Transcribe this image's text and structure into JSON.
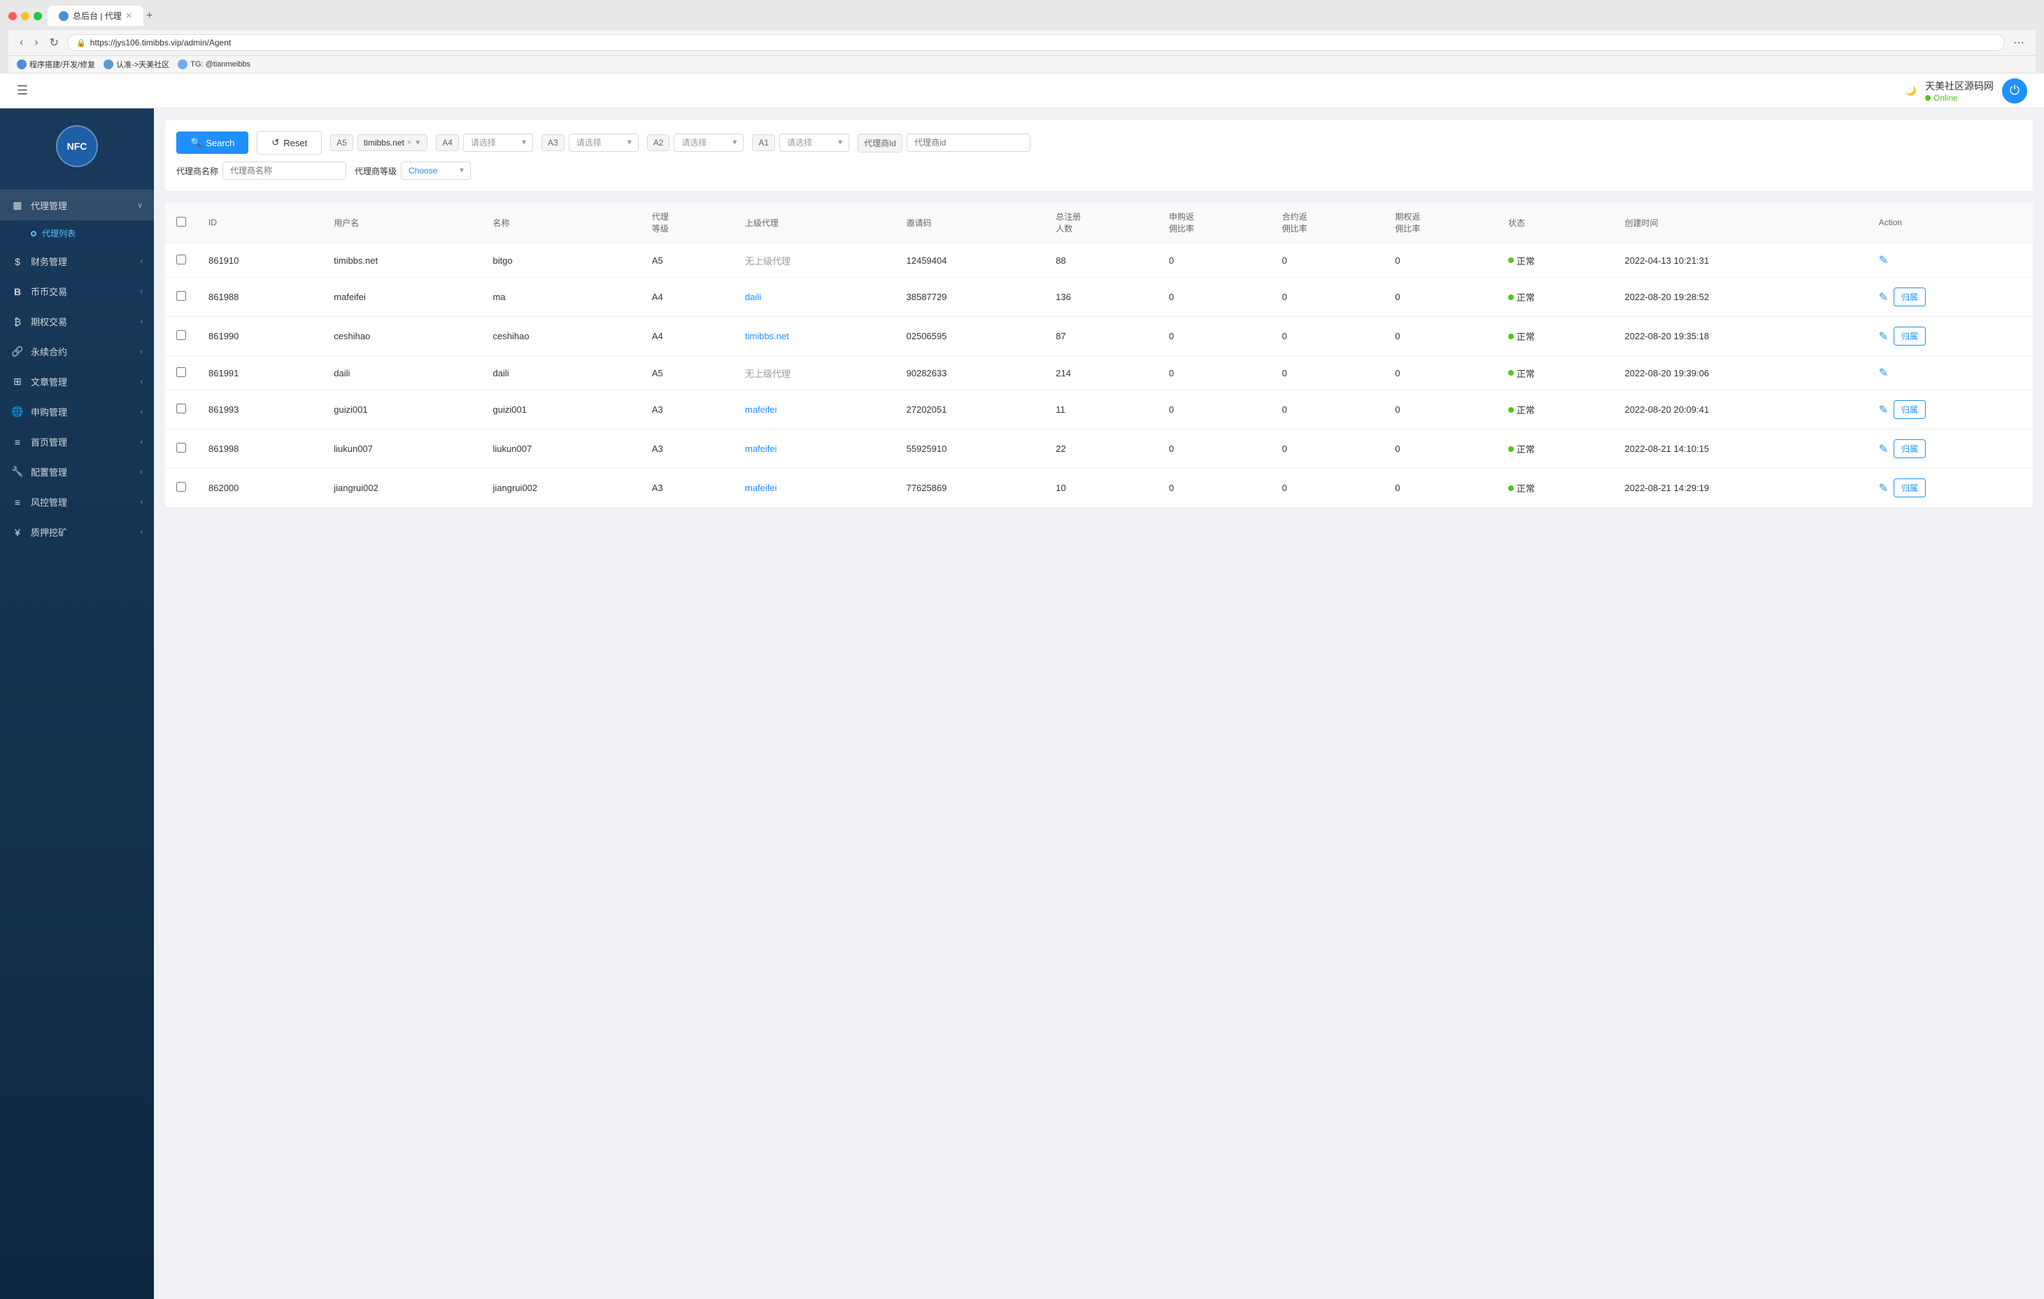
{
  "browser": {
    "traffic_lights": [
      "red",
      "yellow",
      "green"
    ],
    "tab_title": "总后台 | 代理",
    "url": "https://jys106.timibbs.vip/admin/Agent",
    "new_tab_label": "+",
    "bookmarks": [
      {
        "label": "程序搭建/开发/修复",
        "color": "#4a90d9"
      },
      {
        "label": "认准->天美社区",
        "color": "#5b9bd5"
      },
      {
        "label": "TG: @tianmeibbs",
        "color": "#6aafeb"
      }
    ]
  },
  "header": {
    "site_name": "天美社区源码网",
    "online_label": "Online",
    "moon_icon": "🌙",
    "power_icon": "⏻"
  },
  "sidebar": {
    "logo_text": "NFC",
    "nav_items": [
      {
        "id": "agent",
        "icon": "▦",
        "label": "代理管理",
        "has_arrow": true,
        "active": true,
        "sub_items": [
          {
            "label": "代理列表",
            "active": true
          }
        ]
      },
      {
        "id": "finance",
        "icon": "$",
        "label": "财务管理",
        "has_arrow": true
      },
      {
        "id": "coin",
        "icon": "B",
        "label": "币币交易",
        "has_arrow": true
      },
      {
        "id": "options",
        "icon": "₿",
        "label": "期权交易",
        "has_arrow": true
      },
      {
        "id": "perpetual",
        "icon": "🔗",
        "label": "永续合约",
        "has_arrow": true
      },
      {
        "id": "article",
        "icon": "⊞",
        "label": "文章管理",
        "has_arrow": true
      },
      {
        "id": "subscribe",
        "icon": "🌐",
        "label": "申购管理",
        "has_arrow": true
      },
      {
        "id": "homepage",
        "icon": "≡",
        "label": "首页管理",
        "has_arrow": true
      },
      {
        "id": "config",
        "icon": "🔧",
        "label": "配置管理",
        "has_arrow": true
      },
      {
        "id": "risk",
        "icon": "≡",
        "label": "风控管理",
        "has_arrow": true
      },
      {
        "id": "pledge",
        "icon": "¥",
        "label": "质押挖矿",
        "has_arrow": true
      }
    ]
  },
  "filter": {
    "search_label": "Search",
    "reset_label": "Reset",
    "filters": [
      {
        "tag": "A5",
        "value": "timibbs.net",
        "has_delete": true
      },
      {
        "tag": "A4",
        "placeholder": "请选择"
      },
      {
        "tag": "A3",
        "placeholder": "请选择"
      },
      {
        "tag": "A2",
        "placeholder": "请选择"
      },
      {
        "tag": "A1",
        "placeholder": "请选择"
      },
      {
        "tag": "代理商Id",
        "placeholder": "代理商id"
      }
    ],
    "agent_name_label": "代理商名称",
    "agent_name_placeholder": "代理商名称",
    "agent_level_label": "代理商等级",
    "choose_label": "Choose"
  },
  "table": {
    "columns": [
      "",
      "ID",
      "用户名",
      "名称",
      "代理等级",
      "上级代理",
      "邀请码",
      "总注册人数",
      "申购返佣比率",
      "合约返佣比率",
      "期权返佣比率",
      "状态",
      "创建时间",
      "Action"
    ],
    "rows": [
      {
        "id": "861910",
        "username": "timibbs.net",
        "name": "bitgo",
        "level": "A5",
        "parent": "无上级代理",
        "parent_link": false,
        "invite_code": "12459404",
        "total_users": "88",
        "subscribe_ratio": "0",
        "contract_ratio": "0",
        "options_ratio": "0",
        "status": "正常",
        "created_time": "2022-04-13 10:21:31",
        "has_assign": false
      },
      {
        "id": "861988",
        "username": "mafeifei",
        "name": "ma",
        "level": "A4",
        "parent": "daili",
        "parent_link": true,
        "invite_code": "38587729",
        "total_users": "136",
        "subscribe_ratio": "0",
        "contract_ratio": "0",
        "options_ratio": "0",
        "status": "正常",
        "created_time": "2022-08-20 19:28:52",
        "has_assign": true
      },
      {
        "id": "861990",
        "username": "ceshihao",
        "name": "ceshihao",
        "level": "A4",
        "parent": "timibbs.net",
        "parent_link": true,
        "invite_code": "02506595",
        "total_users": "87",
        "subscribe_ratio": "0",
        "contract_ratio": "0",
        "options_ratio": "0",
        "status": "正常",
        "created_time": "2022-08-20 19:35:18",
        "has_assign": true
      },
      {
        "id": "861991",
        "username": "daili",
        "name": "daili",
        "level": "A5",
        "parent": "无上级代理",
        "parent_link": false,
        "invite_code": "90282633",
        "total_users": "214",
        "subscribe_ratio": "0",
        "contract_ratio": "0",
        "options_ratio": "0",
        "status": "正常",
        "created_time": "2022-08-20 19:39:06",
        "has_assign": false
      },
      {
        "id": "861993",
        "username": "guizi001",
        "name": "guizi001",
        "level": "A3",
        "parent": "mafeifei",
        "parent_link": true,
        "invite_code": "27202051",
        "total_users": "11",
        "subscribe_ratio": "0",
        "contract_ratio": "0",
        "options_ratio": "0",
        "status": "正常",
        "created_time": "2022-08-20 20:09:41",
        "has_assign": true
      },
      {
        "id": "861998",
        "username": "liukun007",
        "name": "liukun007",
        "level": "A3",
        "parent": "mafeifei",
        "parent_link": true,
        "invite_code": "55925910",
        "total_users": "22",
        "subscribe_ratio": "0",
        "contract_ratio": "0",
        "options_ratio": "0",
        "status": "正常",
        "created_time": "2022-08-21 14:10:15",
        "has_assign": true
      },
      {
        "id": "862000",
        "username": "jiangrui002",
        "name": "jiangrui002",
        "level": "A3",
        "parent": "mafeifei",
        "parent_link": true,
        "invite_code": "77625869",
        "total_users": "10",
        "subscribe_ratio": "0",
        "contract_ratio": "0",
        "options_ratio": "0",
        "status": "正常",
        "created_time": "2022-08-21 14:29:19",
        "has_assign": true
      }
    ],
    "assign_label": "归属",
    "edit_icon": "✎"
  }
}
